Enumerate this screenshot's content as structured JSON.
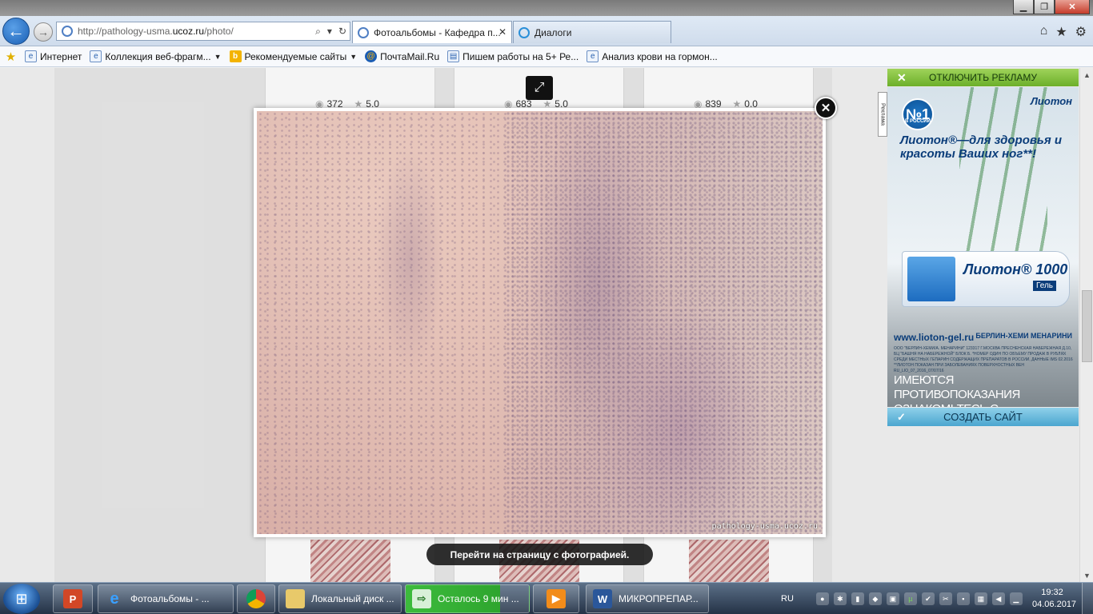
{
  "window": {
    "title": "",
    "controls": {
      "minimize": "▁",
      "maximize": "❐",
      "close": "✕"
    }
  },
  "browser": {
    "url_prefix": "http://pathology-usma.",
    "url_domain": "ucoz.ru",
    "url_path": "/photo/",
    "address_tools": {
      "search": "⌕",
      "dropdown": "▾",
      "refresh": "↻"
    },
    "tabs": [
      {
        "label": "Фотоальбомы - Кафедра п...",
        "close": "✕"
      },
      {
        "label": "Диалоги"
      }
    ],
    "right_icons": {
      "home": "⌂",
      "favorites": "★",
      "tools": "⚙"
    }
  },
  "favorites": [
    {
      "label": "Интернет"
    },
    {
      "label": "Коллекция веб-фрагм...",
      "caret": "▼"
    },
    {
      "label": "Рекомендуемые сайты",
      "caret": "▼"
    },
    {
      "label": "ПочтаMail.Ru"
    },
    {
      "label": "Пишем работы на 5+  Ре..."
    },
    {
      "label": "Анализ крови на гормон..."
    }
  ],
  "gallery": {
    "items": [
      {
        "views": "372",
        "rating": "5.0"
      },
      {
        "views": "683",
        "rating": "5.0"
      },
      {
        "views": "839",
        "rating": "0.0"
      }
    ]
  },
  "lightbox": {
    "watermark": "pathology-usma.ucoz.ru",
    "goto_label": "Перейти на страницу с фотографией.",
    "close": "✕",
    "expand": "⤢"
  },
  "ad": {
    "disable_label": "ОТКЛЮЧИТЬ РЕКЛАМУ",
    "disable_x": "✕",
    "badge_number": "№1",
    "badge_sub": "В РОССИИ",
    "brand": "Лиотон",
    "headline": "Лиотон®—для здоровья и красоты Ваших ног**!",
    "product_name": "Лиотон® 1000",
    "product_type": "Гель",
    "site_url": "www.lioton-gel.ru",
    "maker": "БЕРЛИН-ХЕМИ МЕНАРИНИ",
    "fine_print": "ООО \"БЕРЛИН-ХЕМИ/А. МЕНАРИНИ\" 123317 Г.МОСКВА ПРЕСНЕНСКАЯ НАБЕРЕЖНАЯ Д.10, БЦ \"БАШНЯ НА НАБЕРЕЖНОЙ\" БЛОК Б. *НОМЕР ОДИН ПО ОБЪЕМУ ПРОДАЖ В РУБЛЯХ СРЕДИ МЕСТНЫХ ГЕПАРИН СОДЕРЖАЩИХ ПРЕПАРАТОВ В РОССИИ, ДАННЫЕ IMS 02.2016 **ЛИОТОН ПОКАЗАН ПРИ ЗАБОЛЕВАНИЯХ ПОВЕРХНОСТНЫХ ВЕН RU_LIO_07_2016_07/07/16",
    "warning": "ИМЕЮТСЯ ПРОТИВОПОКАЗАНИЯ ОЗНАКОМЬТЕСЬ С ИНСТРУКЦИЕЙ ПО ПРИМЕНЕНИЮ",
    "side_label": "Реклама",
    "create_site_label": "СОЗДАТЬ САЙТ",
    "create_check": "✓"
  },
  "taskbar": {
    "items": [
      {
        "label": "Фотоальбомы - ..."
      },
      {
        "label": "Локальный диск ..."
      },
      {
        "label": "Осталось 9 мин ..."
      },
      {
        "label": "МИКРОПРЕПАР..."
      }
    ],
    "language": "RU",
    "time": "19:32",
    "date": "04.06.2017"
  },
  "colors": {
    "accent_ie": "#1a5fb4",
    "ad_green": "#6caf2a",
    "ad_blue": "#4ba6cf",
    "lightbox_dark": "#111111"
  }
}
